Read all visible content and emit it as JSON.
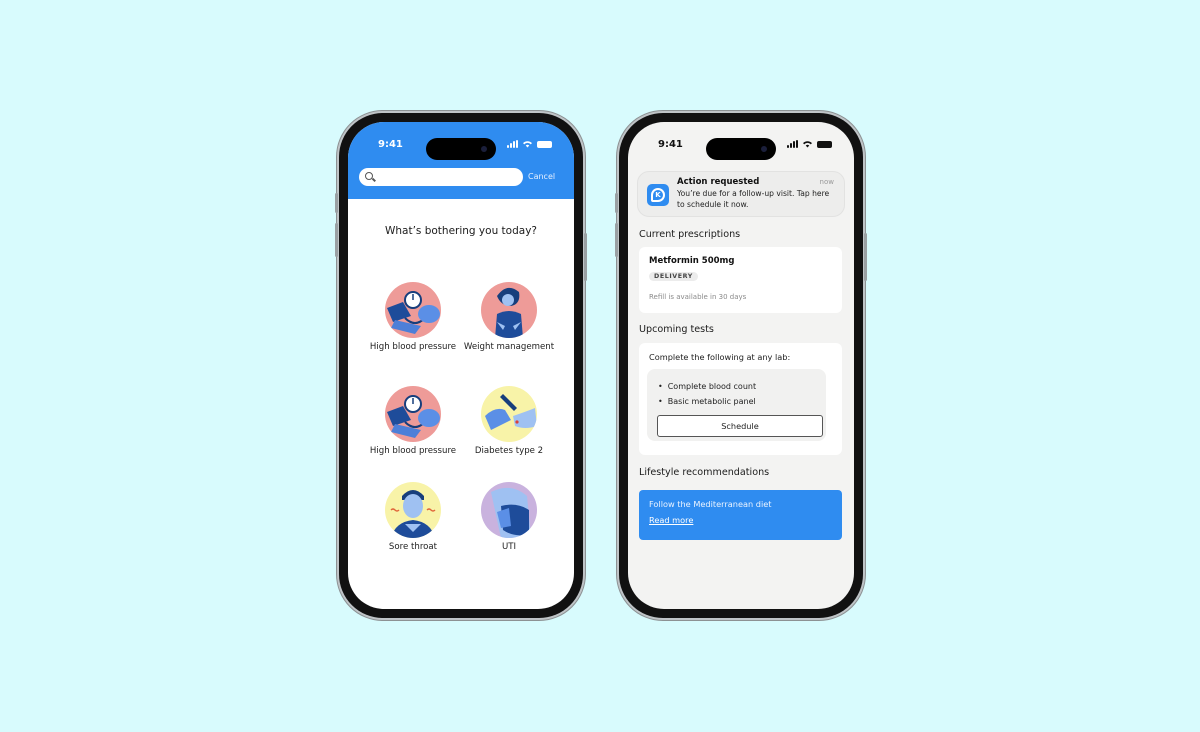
{
  "phone_left": {
    "status_bar": {
      "time": "9:41"
    },
    "search": {
      "placeholder": "",
      "cancel_label": "Cancel"
    },
    "question": "What’s bothering you today?",
    "conditions": [
      {
        "label": "High blood pressure",
        "icon": "blood-pressure-cuff-icon",
        "bg": "#ee9b98"
      },
      {
        "label": "Weight management",
        "icon": "weight-woman-icon",
        "bg": "#ee9b98"
      },
      {
        "label": "High blood pressure",
        "icon": "blood-pressure-cuff-icon",
        "bg": "#ee9b98"
      },
      {
        "label": "Diabetes type 2",
        "icon": "glucose-lancet-icon",
        "bg": "#f8f3a8"
      },
      {
        "label": "Sore throat",
        "icon": "sore-throat-man-icon",
        "bg": "#f8f3a8"
      },
      {
        "label": "UTI",
        "icon": "uti-icon",
        "bg": "#c9b2de"
      }
    ]
  },
  "phone_right": {
    "status_bar": {
      "time": "9:41"
    },
    "notification": {
      "app_icon": "k-logo-icon",
      "app_letter": "K",
      "title": "Action requested",
      "time": "now",
      "body": "You’re due for a follow-up visit. Tap here to schedule it now."
    },
    "prescriptions": {
      "heading": "Current prescriptions",
      "name": "Metformin 500mg",
      "badge": "DELIVERY",
      "refill": "Refill is available in 30 days"
    },
    "tests": {
      "heading": "Upcoming tests",
      "intro": "Complete the following at any lab:",
      "items": [
        "Complete blood count",
        "Basic metabolic panel"
      ],
      "button": "Schedule"
    },
    "lifestyle": {
      "heading": "Lifestyle recommendations",
      "text": "Follow the Mediterranean diet",
      "link": "Read more"
    }
  },
  "colors": {
    "brand_blue": "#2f8cf0",
    "background": "#d8fbfd"
  }
}
